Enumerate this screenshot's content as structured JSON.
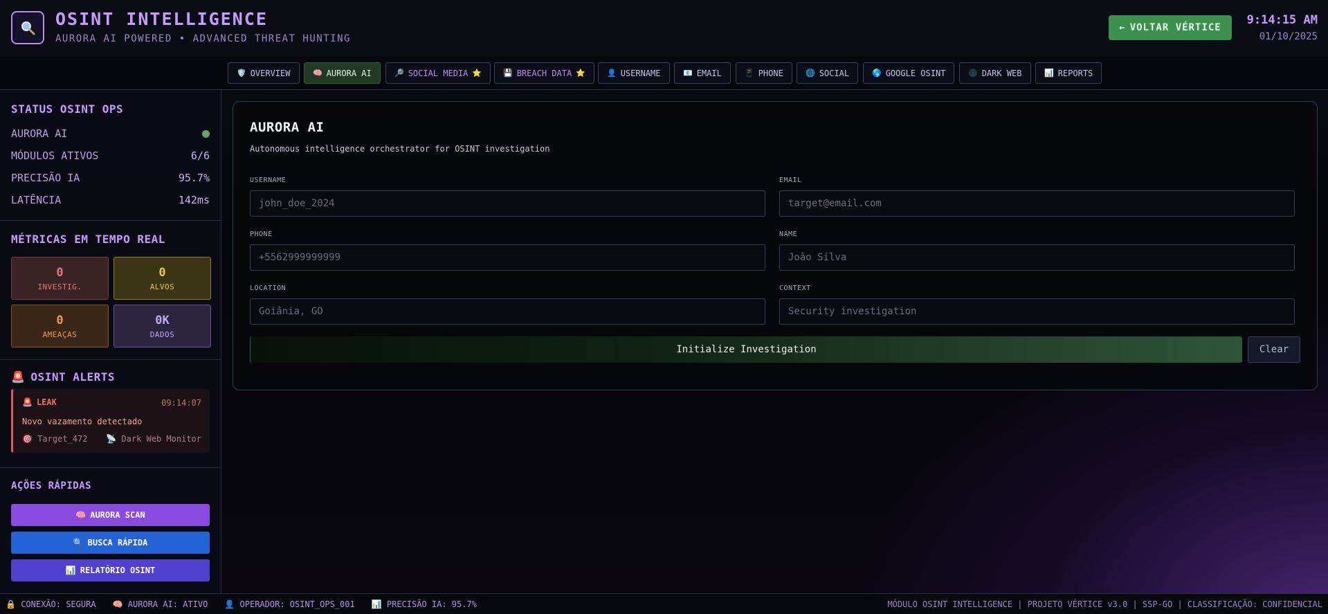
{
  "header": {
    "title": "OSINT INTELLIGENCE",
    "subtitle": "AURORA AI POWERED • ADVANCED THREAT HUNTING",
    "back_button": "VOLTAR VÉRTICE",
    "back_arrow": "←",
    "time": "9:14:15 AM",
    "date": "01/10/2025",
    "logo_icon": "magnifier-icon"
  },
  "tabs": [
    {
      "icon": "🛡️",
      "label": "OVERVIEW"
    },
    {
      "icon": "🧠",
      "label": "AURORA AI",
      "active": true
    },
    {
      "icon": "🔎",
      "label": "SOCIAL MEDIA",
      "star": "⭐"
    },
    {
      "icon": "💾",
      "label": "BREACH DATA",
      "star": "⭐"
    },
    {
      "icon": "👤",
      "label": "USERNAME"
    },
    {
      "icon": "📧",
      "label": "EMAIL"
    },
    {
      "icon": "📱",
      "label": "PHONE"
    },
    {
      "icon": "🌐",
      "label": "SOCIAL"
    },
    {
      "icon": "🌎",
      "label": "GOOGLE OSINT"
    },
    {
      "icon": "🌑",
      "label": "DARK WEB"
    },
    {
      "icon": "📊",
      "label": "REPORTS"
    }
  ],
  "sidebar": {
    "status": {
      "title": "STATUS OSINT OPS",
      "rows": [
        {
          "label": "AURORA AI",
          "value": ""
        },
        {
          "label": "MÓDULOS ATIVOS",
          "value": "6/6"
        },
        {
          "label": "PRECISÃO IA",
          "value": "95.7%"
        },
        {
          "label": "LATÊNCIA",
          "value": "142ms"
        }
      ]
    },
    "metrics": {
      "title": "MÉTRICAS EM TEMPO REAL",
      "items": [
        {
          "value": "0",
          "label": "INVESTIG."
        },
        {
          "value": "0",
          "label": "ALVOS"
        },
        {
          "value": "0",
          "label": "AMEAÇAS"
        },
        {
          "value": "0K",
          "label": "DADOS"
        }
      ]
    },
    "alerts": {
      "icon": "🚨",
      "title": "OSINT ALERTS",
      "item": {
        "icon": "🚨",
        "type": "LEAK",
        "time": "09:14:07",
        "message": "Novo vazamento detectado",
        "target_icon": "🎯",
        "target": "Target_472",
        "source_icon": "📡",
        "source": "Dark Web Monitor"
      }
    },
    "quick": {
      "title": "AÇÕES RÁPIDAS",
      "buttons": [
        {
          "icon": "🧠",
          "label": "AURORA SCAN"
        },
        {
          "icon": "🔍",
          "label": "BUSCA RÁPIDA"
        },
        {
          "icon": "📊",
          "label": "RELATÓRIO OSINT"
        }
      ]
    }
  },
  "main": {
    "title": "AURORA AI",
    "description": "Autonomous intelligence orchestrator for OSINT investigation",
    "fields": {
      "username": {
        "label": "USERNAME",
        "placeholder": "john_doe_2024"
      },
      "email": {
        "label": "EMAIL",
        "placeholder": "target@email.com"
      },
      "phone": {
        "label": "PHONE",
        "placeholder": "+5562999999999"
      },
      "name": {
        "label": "NAME",
        "placeholder": "João Silva"
      },
      "location": {
        "label": "LOCATION",
        "placeholder": "Goiânia, GO"
      },
      "context": {
        "label": "CONTEXT",
        "placeholder": "Security investigation"
      }
    },
    "init_button": "Initialize Investigation",
    "clear_button": "Clear"
  },
  "footer": {
    "items": [
      {
        "icon": "🔒",
        "text": "CONEXÃO: SEGURA"
      },
      {
        "icon": "🧠",
        "text": "AURORA AI: ATIVO"
      },
      {
        "icon": "👤",
        "text": "OPERADOR: OSINT_OPS_001"
      },
      {
        "icon": "📊",
        "text": "PRECISÃO IA: 95.7%"
      }
    ],
    "right": "MÓDULO OSINT INTELLIGENCE | PROJETO VÉRTICE v3.0 | SSP-GO | CLASSIFICAÇÃO: CONFIDENCIAL"
  },
  "colors": {
    "accent": "#c79bff",
    "success": "#3d8f4e",
    "status_dot": "#5fa76b",
    "alert": "#e25b5b"
  }
}
